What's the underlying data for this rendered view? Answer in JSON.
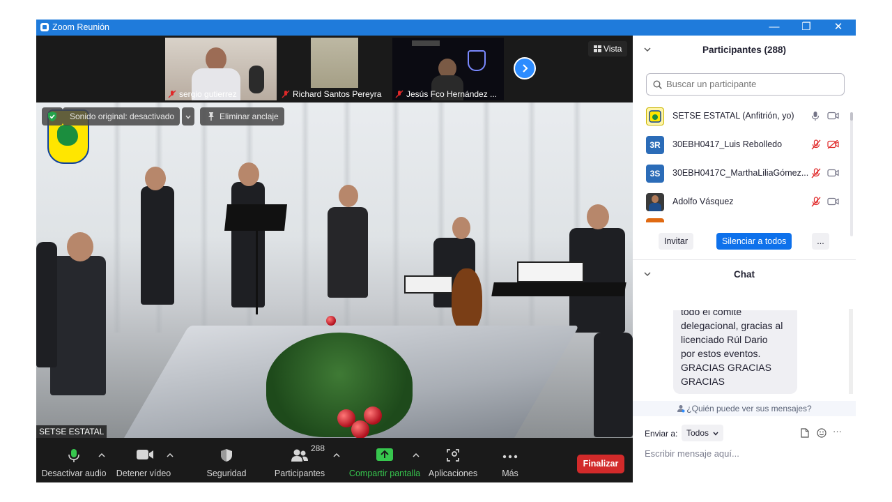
{
  "window": {
    "title": "Zoom Reunión",
    "controls": [
      "—",
      "❐",
      "✕"
    ]
  },
  "gallery": {
    "thumbnails": [
      {
        "name": "sergio gutierrez"
      },
      {
        "name": "Richard Santos Pereyra"
      },
      {
        "name": "Jesús Fco Hernández ..."
      }
    ],
    "view_label": "Vista"
  },
  "main_video": {
    "original_sound": "Sonido original: desactivado",
    "unpin": "Eliminar anclaje",
    "speaker_name": "SETSE ESTATAL"
  },
  "toolbar": {
    "mute": "Desactivar audio",
    "stop_video": "Detener vídeo",
    "security": "Seguridad",
    "participants": "Participantes",
    "participants_count": "288",
    "share": "Compartir pantalla",
    "apps": "Aplicaciones",
    "more": "Más",
    "end": "Finalizar",
    "share_color": "#37c64e",
    "end_color": "#d22a2a"
  },
  "participants_panel": {
    "title": "Participantes (288)",
    "search_placeholder": "Buscar un participante",
    "items": [
      {
        "name": "SETSE ESTATAL (Anfitrión, yo)",
        "avatar": "logo",
        "muted": false,
        "video_off": false
      },
      {
        "name": "30EBH0417_Luis Rebolledo",
        "avatar": "3R",
        "muted": true,
        "video_off": true
      },
      {
        "name": "30EBH0417C_MarthaLiliaGómez...",
        "avatar": "3S",
        "muted": true,
        "video_off": false
      },
      {
        "name": "Adolfo Vásquez",
        "avatar": "photo",
        "muted": true,
        "video_off": false
      }
    ],
    "invite": "Invitar",
    "mute_all": "Silenciar a todos",
    "more": "..."
  },
  "chat_panel": {
    "title": "Chat",
    "message_lines": [
      "todo el comité",
      "delegacional, gracias al",
      "licenciado Rúl Dario",
      "por estos eventos.",
      "GRACIAS GRACIAS",
      "GRACIAS"
    ],
    "who_can_see": "¿Quién puede ver sus mensajes?",
    "send_to_label": "Enviar a:",
    "send_to_value": "Todos",
    "more": "···",
    "input_placeholder": "Escribir mensaje aquí..."
  }
}
